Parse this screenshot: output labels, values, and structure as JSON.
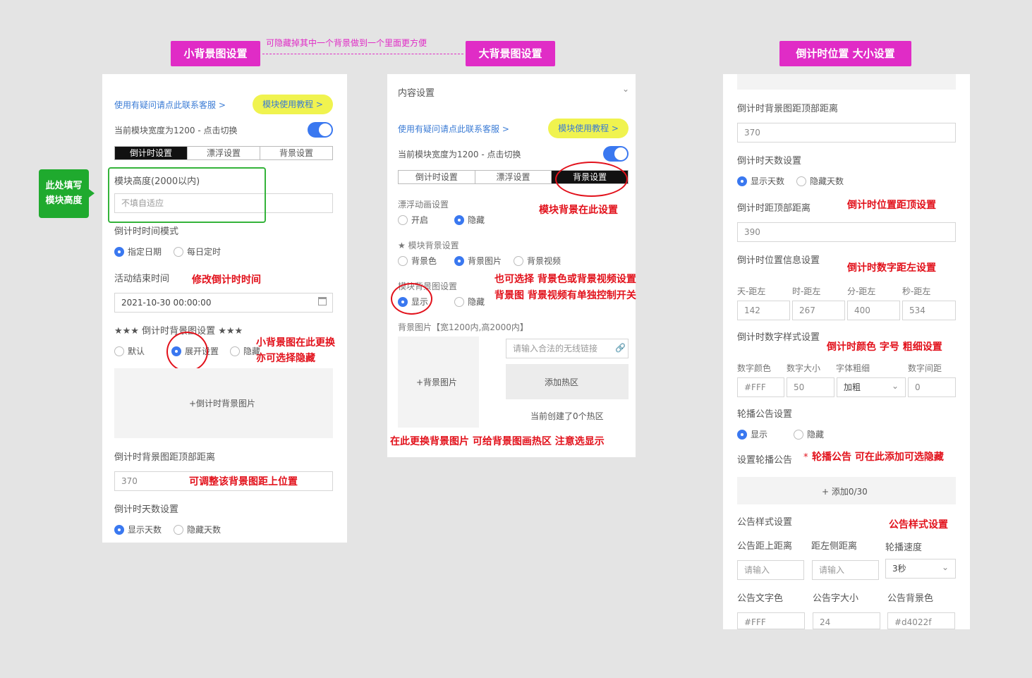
{
  "headers": {
    "small_bg": "小背景图设置",
    "large_bg": "大背景图设置",
    "countdown_pos": "倒计时位置 大小设置",
    "between_hint": "可隐藏掉其中一个背景做到一个里面更方便"
  },
  "left": {
    "help_link": "使用有疑问请点此联系客服 >",
    "tutorial_btn": "模块使用教程 >",
    "width_label": "当前模块宽度为1200 - 点击切换",
    "tabs": [
      "倒计时设置",
      "漂浮设置",
      "背景设置"
    ],
    "height_label": "模块高度(2000以内)",
    "height_placeholder": "不填自适应",
    "green_note_1": "此处填写",
    "green_note_2": "模块高度",
    "time_mode_label": "倒计时时间模式",
    "mode_opt1": "指定日期",
    "mode_opt2": "每日定时",
    "end_time_label": "活动结束时间",
    "end_time_note": "修改倒计时时间",
    "end_time_value": "2021-10-30 00:00:00",
    "bg_section_label": "★★★ 倒计时背景图设置 ★★★",
    "bg_opt1": "默认",
    "bg_opt2": "展开设置",
    "bg_opt3": "隐藏",
    "bg_note_1": "小背景图在此更换",
    "bg_note_2": "亦可选择隐藏",
    "upload_label": "+倒计时背景图片",
    "top_dist_label": "倒计时背景图距顶部距离",
    "top_dist_value": "370",
    "top_dist_note": "可调整该背景图距上位置",
    "days_label": "倒计时天数设置",
    "days_opt1": "显示天数",
    "days_opt2": "隐藏天数"
  },
  "middle": {
    "title": "内容设置",
    "help_link": "使用有疑问请点此联系客服 >",
    "tutorial_btn": "模块使用教程 >",
    "width_label": "当前模块宽度为1200 - 点击切换",
    "tabs": [
      "倒计时设置",
      "漂浮设置",
      "背景设置"
    ],
    "float_anim_label": "漂浮动画设置",
    "float_opt1": "开启",
    "float_opt2": "隐藏",
    "bg_here_note": "模块背景在此设置",
    "module_bg_label": "★ 模块背景设置",
    "mbg_opt1": "背景色",
    "mbg_opt2": "背景图片",
    "mbg_opt3": "背景视频",
    "or_note_1": "也可选择 背景色或背景视频设置",
    "or_note_2": "背景图 背景视频有单独控制开关",
    "bgimg_label": "模块背景图设置",
    "bgimg_opt1": "显示",
    "bgimg_opt2": "隐藏",
    "bgimg_size_label": "背景图片【宽1200内,高2000内】",
    "upload_label": "+背景图片",
    "link_placeholder": "请输入合法的无线链接",
    "add_hotspot": "添加热区",
    "hotspot_count": "当前创建了0个热区",
    "bottom_note": "在此更换背景图片 可给背景图画热区 注意选显示"
  },
  "right": {
    "bg_top_label": "倒计时背景图距顶部距离",
    "bg_top_value": "370",
    "days_label": "倒计时天数设置",
    "days_opt1": "显示天数",
    "days_opt2": "隐藏天数",
    "pos_top_label": "倒计时距顶部距离",
    "pos_top_note": "倒计时位置距顶设置",
    "pos_top_value": "390",
    "pos_info_label": "倒计时位置信息设置",
    "pos_info_note": "倒计时数字距左设置",
    "col_labels": [
      "天-距左",
      "时-距左",
      "分-距左",
      "秒-距左"
    ],
    "col_values": [
      "142",
      "267",
      "400",
      "534"
    ],
    "num_style_label": "倒计时数字样式设置",
    "num_style_note": "倒计时颜色 字号 粗细设置",
    "style_labels": [
      "数字颜色",
      "数字大小",
      "字体粗细",
      "数字间距"
    ],
    "style_values": [
      "#FFF",
      "50",
      "加粗",
      "0"
    ],
    "notice_label": "轮播公告设置",
    "notice_opt1": "显示",
    "notice_opt2": "隐藏",
    "set_notice_label": "设置轮播公告",
    "set_notice_star": "*",
    "set_notice_note": "轮播公告 可在此添加可选隐藏",
    "add_notice": "+ 添加0/30",
    "notice_style_label": "公告样式设置",
    "notice_style_note": "公告样式设置",
    "ns_labels": [
      "公告距上距离",
      "距左侧距离",
      "轮播速度"
    ],
    "ns_values": [
      "请输入",
      "请输入",
      "3秒"
    ],
    "nc_labels": [
      "公告文字色",
      "公告字大小",
      "公告背景色"
    ],
    "nc_values": [
      "#FFF",
      "24",
      "#d4022f"
    ]
  },
  "colors": {
    "accent_tag": "#e02cc6",
    "note_red": "#e2111b",
    "toggle_blue": "#3a78f0",
    "green": "#1faa2e",
    "pill_yellow": "#f0f34f"
  }
}
